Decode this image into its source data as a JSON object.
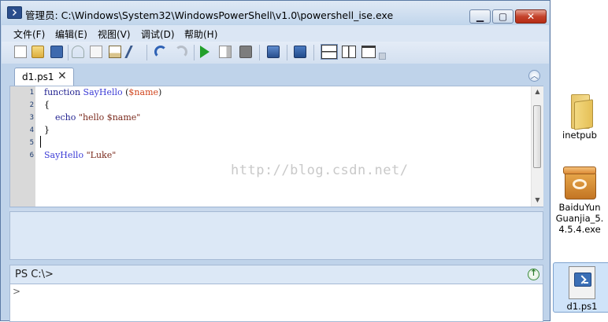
{
  "window": {
    "title": "管理员: C:\\Windows\\System32\\WindowsPowerShell\\v1.0\\powershell_ise.exe",
    "controls": {
      "minimize": "▁",
      "maximize": "▢",
      "close": "✕"
    }
  },
  "menu": {
    "items": [
      "文件(F)",
      "编辑(E)",
      "视图(V)",
      "调试(D)",
      "帮助(H)"
    ]
  },
  "toolbar": {
    "buttons": [
      "new-icon",
      "open-icon",
      "save-icon",
      "cut-icon",
      "copy-icon",
      "paste-icon",
      "clear-icon",
      "undo-icon",
      "redo-icon",
      "run-icon",
      "run-selection-icon",
      "stop-icon",
      "remote-powershell-icon",
      "powershell-console-icon",
      "layout-top-icon",
      "layout-right-icon",
      "layout-max-icon"
    ]
  },
  "tab": {
    "label": "d1.ps1",
    "close": "✕"
  },
  "editor": {
    "line_numbers": [
      "1",
      "2",
      "3",
      "4",
      "5",
      "6"
    ],
    "watermark": "http://blog.csdn.net/"
  },
  "command_pane": {
    "prompt": "PS C:\\>",
    "input_prefix": ">"
  },
  "desktop": {
    "icons": [
      {
        "label": "inetpub",
        "icon": "folder-icon"
      },
      {
        "label": "BaiduYun Guanjia_5. 4.5.4.exe",
        "icon": "installer-icon"
      },
      {
        "label": "d1.ps1",
        "icon": "powershell-script-icon"
      }
    ]
  },
  "colors": {
    "title_gradient": "#dfe9f5",
    "keyword": "#1f1f8f",
    "function_name": "#3b3bd6",
    "variable": "#d0431b",
    "string": "#7a2a1d"
  }
}
